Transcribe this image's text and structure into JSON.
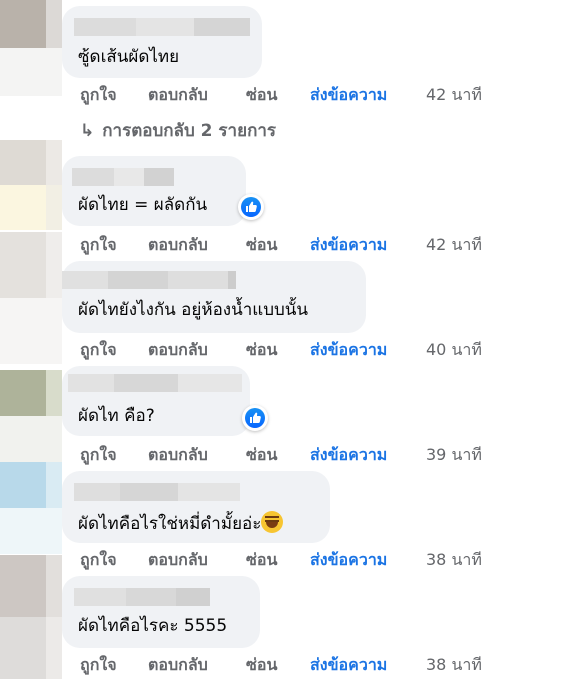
{
  "action_labels": {
    "like": "ถูกใจ",
    "reply": "ตอบกลับ",
    "hide": "ซ่อน",
    "send_message": "ส่งข้อความ"
  },
  "replies_link": "การตอบกลับ 2 รายการ",
  "colors": {
    "bubble": "#f0f2f5",
    "action_text": "#65676b",
    "link_blue": "#1b74e4",
    "like_blue": "#0866ff"
  },
  "comments": [
    {
      "text": "ซู้ดเส้นผัดไทย",
      "time": "42 นาที",
      "reaction": null
    },
    {
      "text": "ผัดไทย = ผลัดกัน",
      "time": "42 นาที",
      "reaction": "like-icon"
    },
    {
      "text": "ผัดไทยังไงกัน อยู่ห้องน้ำแบบนั้น",
      "time": "40 นาที",
      "reaction": null
    },
    {
      "text": "ผัดไท คือ?",
      "time": "39 นาที",
      "reaction": "like-icon"
    },
    {
      "text": "ผัดไทคือไรใช่หมี่ดำมั้ยอ่ะ",
      "emoji": "rofl-emoji",
      "time": "38 นาที",
      "reaction": null
    },
    {
      "text": "ผัดไทคือไรคะ 5555",
      "time": "38 นาที",
      "reaction": null
    }
  ]
}
